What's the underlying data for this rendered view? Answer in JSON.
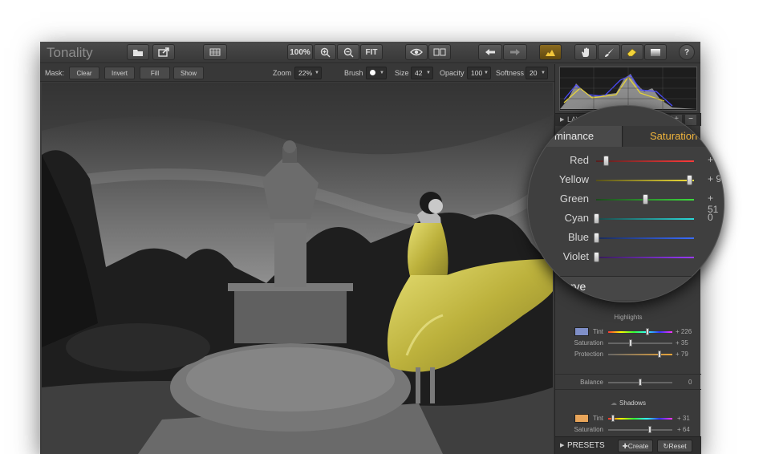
{
  "app": {
    "title": "Tonality"
  },
  "toolbar": {
    "zoom_pct": "100%",
    "fit": "FIT"
  },
  "maskbar": {
    "mask_label": "Mask:",
    "clear": "Clear",
    "invert": "Invert",
    "fill": "Fill",
    "show": "Show",
    "zoom_label": "Zoom",
    "zoom_value": "22%",
    "brush_label": "Brush",
    "size_label": "Size",
    "size_value": "42",
    "opacity_label": "Opacity",
    "opacity_value": "100",
    "softness_label": "Softness",
    "softness_value": "20"
  },
  "layers": {
    "label": "LAYE",
    "add": "+",
    "remove": "−"
  },
  "tabs": {
    "left": "minance",
    "right": "Saturation"
  },
  "saturation": [
    {
      "label": "Red",
      "value": "+",
      "level": 0.1,
      "colors": [
        "#552020",
        "#ff3a3a"
      ]
    },
    {
      "label": "Yellow",
      "value": "+ 9",
      "level": 0.98,
      "colors": [
        "#55501a",
        "#f4e23a"
      ]
    },
    {
      "label": "Green",
      "value": "+ 51",
      "level": 0.52,
      "colors": [
        "#1d4a1d",
        "#3ddb3d"
      ]
    },
    {
      "label": "Cyan",
      "value": "0",
      "level": 0.0,
      "colors": [
        "#1a4848",
        "#2ad8d8"
      ]
    },
    {
      "label": "Blue",
      "value": "",
      "level": 0.0,
      "colors": [
        "#1a2a55",
        "#3a6cff"
      ]
    },
    {
      "label": "Violet",
      "value": "",
      "level": 0.0,
      "colors": [
        "#351a55",
        "#9a3aff"
      ]
    }
  ],
  "curve": {
    "label": "urve"
  },
  "highlights": {
    "title": "Highlights",
    "swatch": "#7f8fc8",
    "tint_label": "Tint",
    "tint_value": "+ 226",
    "tint_level": 0.62,
    "saturation_label": "Saturation",
    "saturation_value": "+ 35",
    "saturation_level": 0.35,
    "protection_label": "Protection",
    "protection_value": "+ 79",
    "protection_level": 0.79
  },
  "balance": {
    "label": "Balance",
    "value": "0",
    "level": 0.5
  },
  "shadows": {
    "title": "Shadows",
    "swatch": "#e8a55a",
    "tint_label": "Tint",
    "tint_value": "+ 31",
    "tint_level": 0.08,
    "saturation_label": "Saturation",
    "saturation_value": "+ 64",
    "saturation_level": 0.64
  },
  "presets": {
    "label": "PRESETS",
    "create": "Create",
    "reset": "Reset"
  }
}
